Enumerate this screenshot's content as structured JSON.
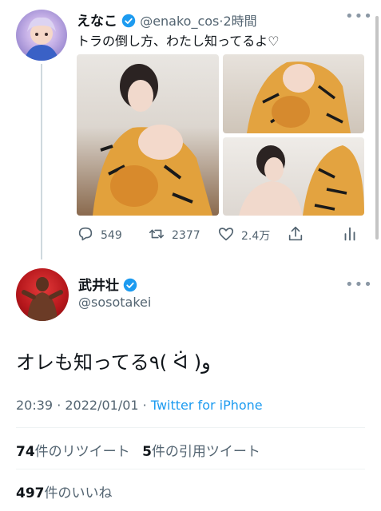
{
  "reply_to_tweet": {
    "display_name": "えなこ",
    "handle": "@enako_cos",
    "separator": "·",
    "time": "2時間",
    "text": "トラの倒し方、わたし知ってるよ♡",
    "verified": true,
    "actions": {
      "reply_count": "549",
      "retweet_count": "2377",
      "like_count": "2.4万",
      "icons": [
        "reply-icon",
        "retweet-icon",
        "heart-icon",
        "share-icon",
        "analytics-icon"
      ]
    }
  },
  "main_tweet": {
    "display_name": "武井壮",
    "handle": "@sosotakei",
    "verified": true,
    "text": "オレも知ってる٩( ᐛ )و",
    "timestamp": "20:39 · 2022/01/01 · ",
    "source": "Twitter for iPhone",
    "retweets": {
      "count": "74",
      "label": "件のリツイート"
    },
    "quotes": {
      "count": "5",
      "label": "件の引用ツイート"
    },
    "likes": {
      "count": "497",
      "label": "件のいいね"
    }
  },
  "colors": {
    "accent": "#1d9bf0",
    "text": "#0f1419",
    "muted": "#536471",
    "divider": "#eff3f4"
  }
}
